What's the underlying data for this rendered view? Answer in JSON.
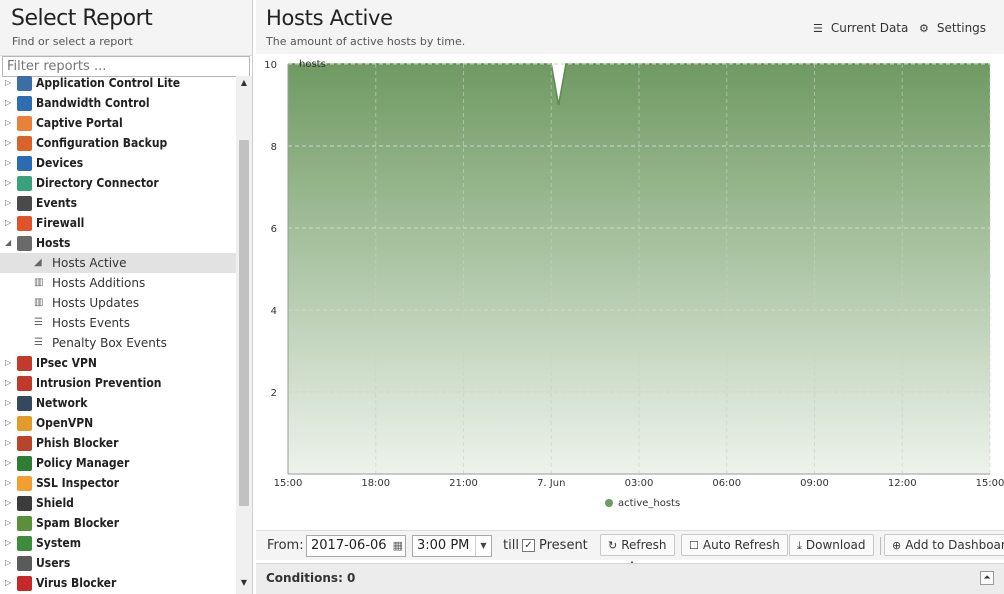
{
  "left": {
    "title": "Select Report",
    "subtitle": "Find or select a report",
    "filter_placeholder": "Filter reports ...",
    "tree": [
      {
        "type": "cat",
        "label": "Application Control Lite",
        "icon": "app-control-icon",
        "color": "#3a6ea5",
        "expanded": false
      },
      {
        "type": "cat",
        "label": "Bandwidth Control",
        "icon": "bandwidth-icon",
        "color": "#2f6db3",
        "expanded": false
      },
      {
        "type": "cat",
        "label": "Captive Portal",
        "icon": "captive-portal-icon",
        "color": "#e8813a",
        "expanded": false
      },
      {
        "type": "cat",
        "label": "Configuration Backup",
        "icon": "config-backup-icon",
        "color": "#d9642b",
        "expanded": false
      },
      {
        "type": "cat",
        "label": "Devices",
        "icon": "devices-icon",
        "color": "#2b6cb0",
        "expanded": false
      },
      {
        "type": "cat",
        "label": "Directory Connector",
        "icon": "directory-icon",
        "color": "#3aa17e",
        "expanded": false
      },
      {
        "type": "cat",
        "label": "Events",
        "icon": "events-icon",
        "color": "#4a4a4a",
        "expanded": false
      },
      {
        "type": "cat",
        "label": "Firewall",
        "icon": "firewall-icon",
        "color": "#e0522a",
        "expanded": false
      },
      {
        "type": "cat",
        "label": "Hosts",
        "icon": "hosts-icon",
        "color": "#6a6a6a",
        "expanded": true
      },
      {
        "type": "sub",
        "label": "Hosts Active",
        "icon": "area-chart-icon",
        "glyph": "◢",
        "selected": true
      },
      {
        "type": "sub",
        "label": "Hosts Additions",
        "icon": "bar-chart-icon",
        "glyph": "▥"
      },
      {
        "type": "sub",
        "label": "Hosts Updates",
        "icon": "bar-chart-icon",
        "glyph": "▥"
      },
      {
        "type": "sub",
        "label": "Hosts Events",
        "icon": "list-icon",
        "glyph": "☰"
      },
      {
        "type": "sub",
        "label": "Penalty Box Events",
        "icon": "list-icon",
        "glyph": "☰"
      },
      {
        "type": "cat",
        "label": "IPsec VPN",
        "icon": "ipsec-icon",
        "color": "#c23a2a",
        "expanded": false
      },
      {
        "type": "cat",
        "label": "Intrusion Prevention",
        "icon": "intrusion-icon",
        "color": "#c0392b",
        "expanded": false
      },
      {
        "type": "cat",
        "label": "Network",
        "icon": "network-icon",
        "color": "#34495e",
        "expanded": false
      },
      {
        "type": "cat",
        "label": "OpenVPN",
        "icon": "openvpn-icon",
        "color": "#e39b2c",
        "expanded": false
      },
      {
        "type": "cat",
        "label": "Phish Blocker",
        "icon": "phish-icon",
        "color": "#b8452a",
        "expanded": false
      },
      {
        "type": "cat",
        "label": "Policy Manager",
        "icon": "policy-icon",
        "color": "#2e7d32",
        "expanded": false
      },
      {
        "type": "cat",
        "label": "SSL Inspector",
        "icon": "ssl-icon",
        "color": "#f0a030",
        "expanded": false
      },
      {
        "type": "cat",
        "label": "Shield",
        "icon": "shield-icon",
        "color": "#3b3b3b",
        "expanded": false
      },
      {
        "type": "cat",
        "label": "Spam Blocker",
        "icon": "spam-icon",
        "color": "#5b8f3a",
        "expanded": false
      },
      {
        "type": "cat",
        "label": "System",
        "icon": "system-icon",
        "color": "#3d8c3d",
        "expanded": false
      },
      {
        "type": "cat",
        "label": "Users",
        "icon": "users-icon",
        "color": "#5a5a5a",
        "expanded": false
      },
      {
        "type": "cat",
        "label": "Virus Blocker",
        "icon": "virus-icon",
        "color": "#c62828",
        "expanded": false
      }
    ]
  },
  "header": {
    "title": "Hosts Active",
    "description": "The amount of active hosts by time.",
    "current_data_label": "Current Data",
    "settings_label": "Settings"
  },
  "chart_data": {
    "type": "area",
    "ylabel": "hosts",
    "ylim": [
      0,
      10
    ],
    "y_ticks": [
      2,
      4,
      6,
      8,
      10
    ],
    "x_ticks": [
      "15:00",
      "18:00",
      "21:00",
      "7. Jun",
      "03:00",
      "06:00",
      "09:00",
      "12:00",
      "15:00"
    ],
    "series": [
      {
        "name": "active_hosts",
        "color": "#6f9a62",
        "x": [
          "15:00",
          "21:00",
          "2017-06-07 00:00",
          "2017-06-07 00:15",
          "2017-06-07 00:30",
          "2017-06-07 15:00"
        ],
        "values": [
          10,
          10,
          10,
          9,
          10,
          10
        ]
      }
    ],
    "legend": "bottom-center",
    "grid": true
  },
  "toolbar": {
    "from_label": "From:",
    "date_value": "2017-06-06",
    "time_value": "3:00 PM",
    "till_label": "till",
    "present_label": "Present",
    "present_checked": true,
    "refresh_label": "Refresh",
    "auto_refresh_label": "Auto Refresh",
    "download_label": "Download",
    "add_dashboard_label": "Add to Dashboard"
  },
  "conditions": {
    "label": "Conditions: 0"
  }
}
